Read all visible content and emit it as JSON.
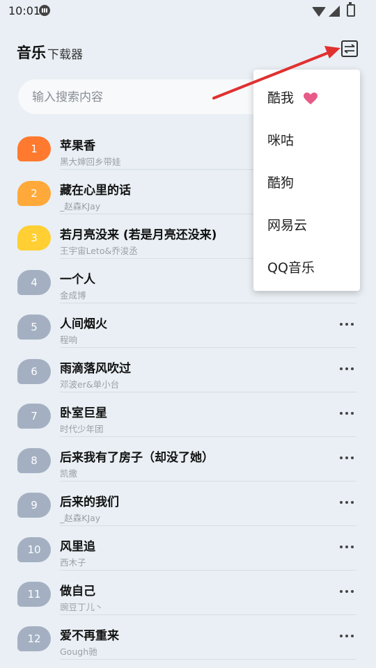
{
  "status": {
    "time": "10:01"
  },
  "header": {
    "title": "音乐",
    "subtitle": "下载器"
  },
  "search": {
    "placeholder": "输入搜索内容"
  },
  "colors": {
    "rank1": "#ff7a2f",
    "rank2": "#ffa93a",
    "rank3": "#ffcf33",
    "rank_default": "#a4b0c2",
    "heart": "#e85a87",
    "arrow": "#e03030"
  },
  "songs": [
    {
      "rank": "1",
      "title": "苹果香",
      "artist": "黑大婶回乡带娃"
    },
    {
      "rank": "2",
      "title": "藏在心里的话",
      "artist": "_赵森KJay"
    },
    {
      "rank": "3",
      "title": "若月亮没来 (若是月亮还没来)",
      "artist": "王宇宙Leto&乔浚丞"
    },
    {
      "rank": "4",
      "title": "一个人",
      "artist": "金成博"
    },
    {
      "rank": "5",
      "title": "人间烟火",
      "artist": "程响"
    },
    {
      "rank": "6",
      "title": "雨滴落风吹过",
      "artist": "邓波er&单小台"
    },
    {
      "rank": "7",
      "title": "卧室巨星",
      "artist": "时代少年团"
    },
    {
      "rank": "8",
      "title": "后来我有了房子（却没了她）",
      "artist": "凯撒"
    },
    {
      "rank": "9",
      "title": "后来的我们",
      "artist": "_赵森KJay"
    },
    {
      "rank": "10",
      "title": "风里追",
      "artist": "西木子"
    },
    {
      "rank": "11",
      "title": "做自己",
      "artist": "豌豆丁儿丶"
    },
    {
      "rank": "12",
      "title": "爱不再重来",
      "artist": "Gough驰"
    }
  ],
  "menu": {
    "items": [
      "酷我",
      "咪咕",
      "酷狗",
      "网易云",
      "QQ音乐"
    ]
  }
}
